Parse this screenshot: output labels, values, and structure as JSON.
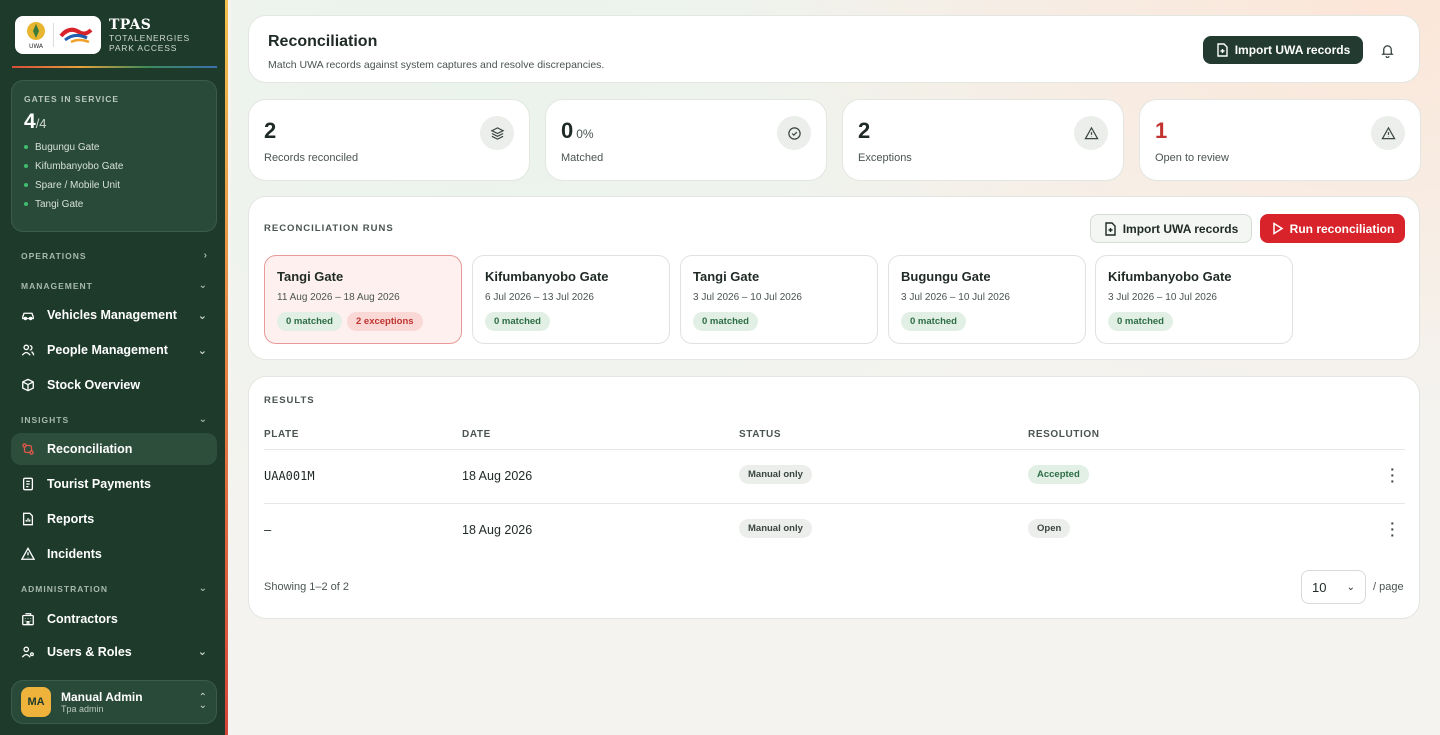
{
  "brand": {
    "title": "TPAS",
    "subtitle_line1": "TOTALENERGIES",
    "subtitle_line2": "PARK ACCESS"
  },
  "gates": {
    "label": "GATES IN SERVICE",
    "active": "4",
    "total": "/4",
    "items": [
      "Bugungu Gate",
      "Kifumbanyobo Gate",
      "Spare / Mobile Unit",
      "Tangi Gate"
    ]
  },
  "nav": {
    "operations": "OPERATIONS",
    "management": "MANAGEMENT",
    "vehicles": "Vehicles Management",
    "people": "People Management",
    "stock": "Stock Overview",
    "insights": "INSIGHTS",
    "reconciliation": "Reconciliation",
    "tourist_payments": "Tourist Payments",
    "reports": "Reports",
    "incidents": "Incidents",
    "administration": "ADMINISTRATION",
    "contractors": "Contractors",
    "users_roles": "Users & Roles"
  },
  "user": {
    "initials": "MA",
    "name": "Manual Admin",
    "role": "Tpa admin"
  },
  "header": {
    "title": "Reconciliation",
    "subtitle": "Match UWA records against system captures and resolve discrepancies.",
    "import_label": "Import UWA records"
  },
  "stats": [
    {
      "value": "2",
      "suffix": "",
      "label": "Records reconciled",
      "icon": "layers-icon"
    },
    {
      "value": "0",
      "suffix": "0%",
      "label": "Matched",
      "icon": "check-circle-icon"
    },
    {
      "value": "2",
      "suffix": "",
      "label": "Exceptions",
      "icon": "warning-icon"
    },
    {
      "value": "1",
      "suffix": "",
      "label": "Open to review",
      "icon": "warning-icon"
    }
  ],
  "runs": {
    "label": "RECONCILIATION RUNS",
    "import_label": "Import UWA records",
    "run_label": "Run reconciliation",
    "items": [
      {
        "name": "Tangi Gate",
        "dates": "11 Aug 2026 – 18 Aug 2026",
        "matched": "0 matched",
        "exceptions": "2 exceptions"
      },
      {
        "name": "Kifumbanyobo Gate",
        "dates": "6 Jul 2026 – 13 Jul 2026",
        "matched": "0 matched"
      },
      {
        "name": "Tangi Gate",
        "dates": "3 Jul 2026 – 10 Jul 2026",
        "matched": "0 matched"
      },
      {
        "name": "Bugungu Gate",
        "dates": "3 Jul 2026 – 10 Jul 2026",
        "matched": "0 matched"
      },
      {
        "name": "Kifumbanyobo Gate",
        "dates": "3 Jul 2026 – 10 Jul 2026",
        "matched": "0 matched"
      }
    ]
  },
  "results": {
    "label": "RESULTS",
    "columns": {
      "plate": "PLATE",
      "date": "DATE",
      "status": "STATUS",
      "resolution": "RESOLUTION"
    },
    "rows": [
      {
        "plate": "UAA001M",
        "date": "18 Aug 2026",
        "status": "Manual only",
        "resolution": "Accepted"
      },
      {
        "plate": "—",
        "date": "18 Aug 2026",
        "status": "Manual only",
        "resolution": "Open"
      }
    ],
    "showing": "Showing 1–2 of 2",
    "per_page_value": "10",
    "per_page_label": "/ page"
  },
  "colors": {
    "sidebar": "#1d3a2b",
    "accent_red": "#d9232a",
    "dark_button": "#233a30",
    "exception_value": "#c0332f"
  }
}
